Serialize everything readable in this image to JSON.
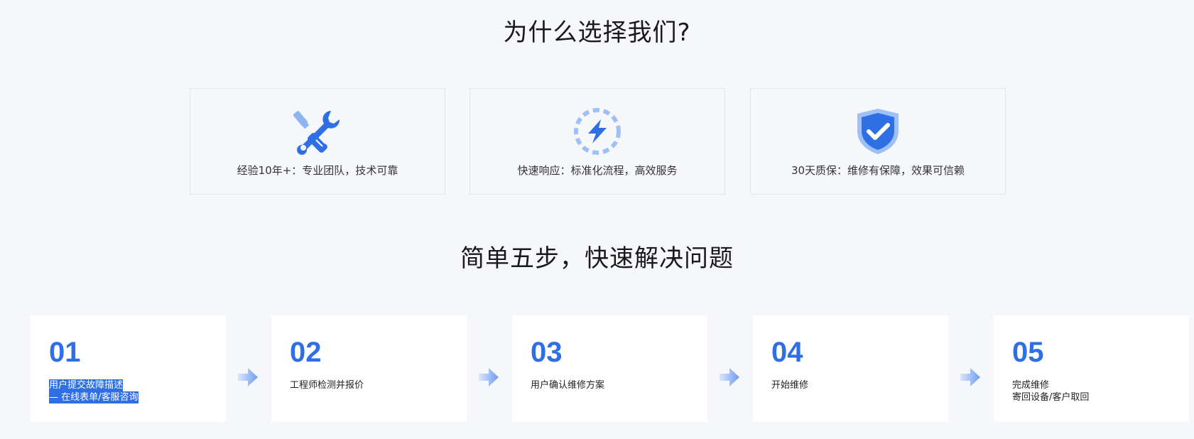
{
  "why": {
    "title": "为什么选择我们?",
    "features": [
      {
        "icon": "wrench-screwdriver-icon",
        "text": "经验10年+：专业团队，技术可靠"
      },
      {
        "icon": "lightning-icon",
        "text": "快速响应：标准化流程，高效服务"
      },
      {
        "icon": "shield-check-icon",
        "text": "30天质保：维修有保障，效果可信赖"
      }
    ]
  },
  "steps": {
    "title": "简单五步，快速解决问题",
    "items": [
      {
        "num": "01",
        "line1": "用户提交故障描述",
        "line2": "— 在线表单/客服咨询"
      },
      {
        "num": "02",
        "line1": "工程师检测并报价",
        "line2": ""
      },
      {
        "num": "03",
        "line1": "用户确认维修方案",
        "line2": ""
      },
      {
        "num": "04",
        "line1": "开始维修",
        "line2": ""
      },
      {
        "num": "05",
        "line1": "完成维修",
        "line2": "寄回设备/客户取回"
      }
    ]
  },
  "colors": {
    "accent": "#2f6fe6",
    "accent_light": "#9fc0f5",
    "background": "#f5f7fb"
  }
}
